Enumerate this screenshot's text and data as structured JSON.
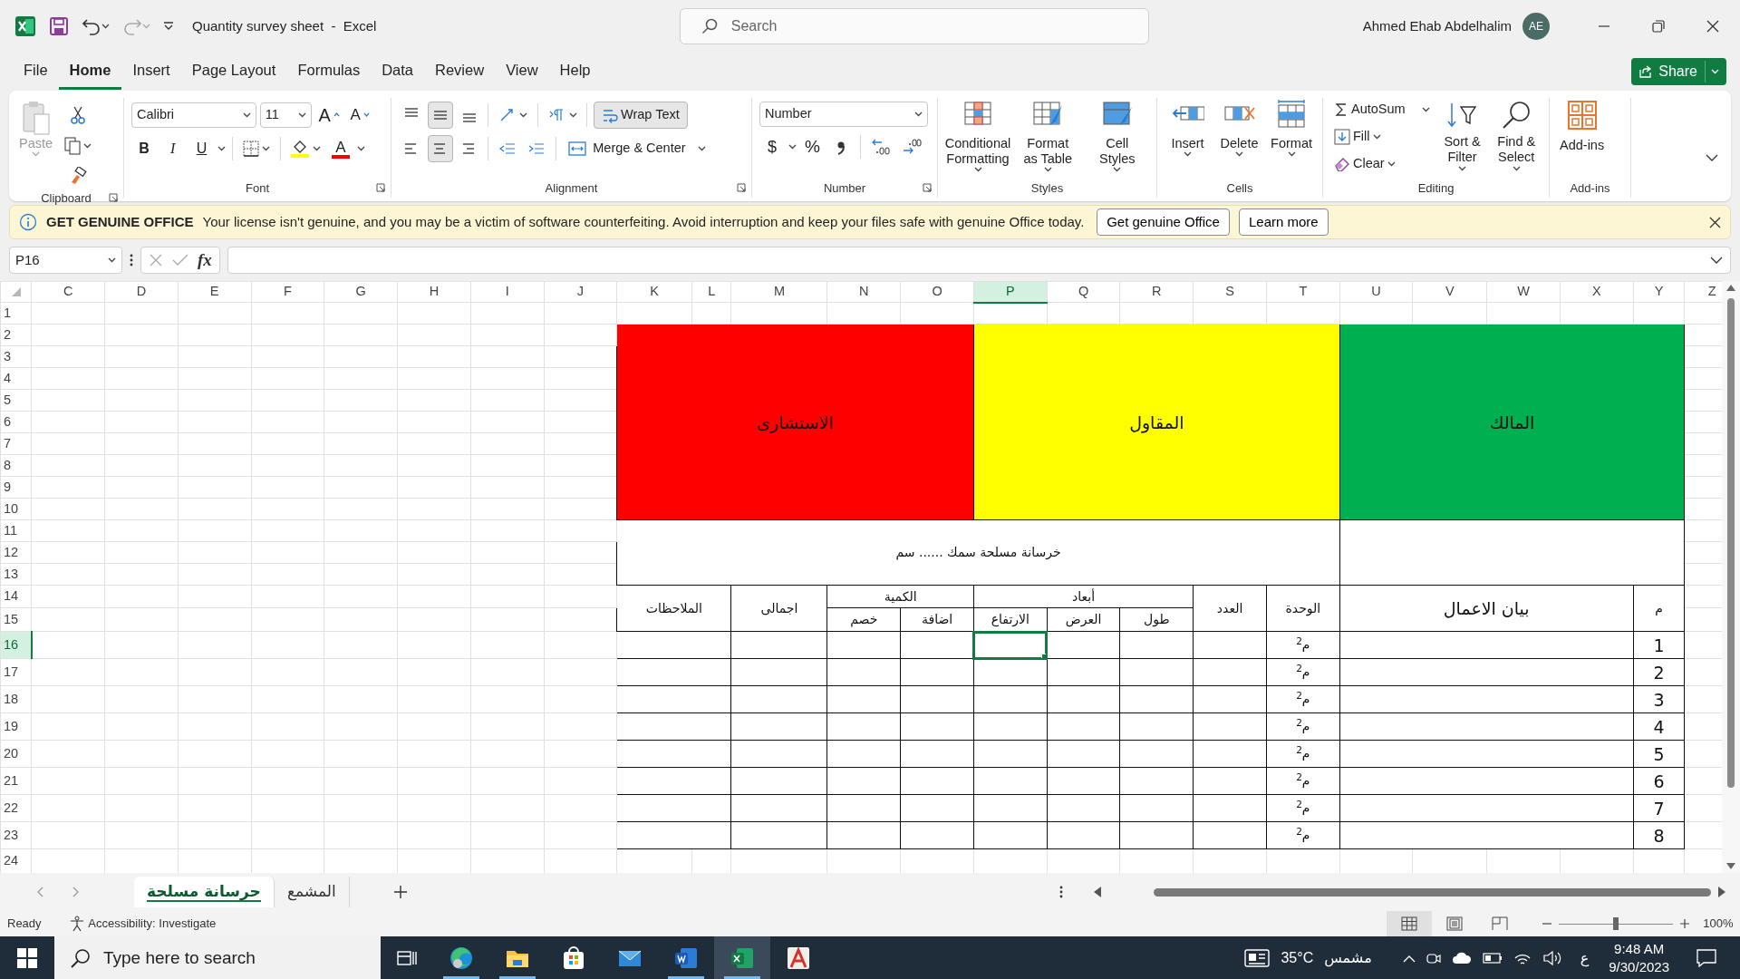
{
  "window": {
    "title": "Quantity survey sheet  -  Excel",
    "search_placeholder": "Search",
    "user": "Ahmed Ehab Abdelhalim",
    "avatar": "AE"
  },
  "menu": [
    {
      "label": "File",
      "selected": false
    },
    {
      "label": "Home",
      "selected": true
    },
    {
      "label": "Insert",
      "selected": false
    },
    {
      "label": "Page Layout",
      "selected": false
    },
    {
      "label": "Formulas",
      "selected": false
    },
    {
      "label": "Data",
      "selected": false
    },
    {
      "label": "Review",
      "selected": false
    },
    {
      "label": "View",
      "selected": false
    },
    {
      "label": "Help",
      "selected": false
    }
  ],
  "share": "Share",
  "ribbon": {
    "clipboard": {
      "label": "Clipboard",
      "paste": "Paste",
      "paste_disabled": true
    },
    "font": {
      "label": "Font",
      "font_name": "Calibri",
      "font_size": "11",
      "grow": "A",
      "shrink": "A",
      "bold": "B",
      "italic": "I",
      "underline": "U",
      "font_color": "A"
    },
    "alignment": {
      "label": "Alignment",
      "vertical": [
        {
          "kind": "top",
          "on": false
        },
        {
          "kind": "middle",
          "on": true
        },
        {
          "kind": "bottom",
          "on": false
        }
      ],
      "horizontal": [
        {
          "kind": "left",
          "on": false
        },
        {
          "kind": "center",
          "on": true
        },
        {
          "kind": "right",
          "on": false
        }
      ],
      "wrap_text": {
        "label": "Wrap Text",
        "on": true
      },
      "merge": "Merge & Center"
    },
    "number": {
      "label": "Number",
      "format": "Number",
      "currency": "$",
      "percent": "%"
    },
    "styles": {
      "label": "Styles",
      "buttons": [
        {
          "kind": "conditional",
          "text": "Conditional Formatting"
        },
        {
          "kind": "table",
          "text": "Format as Table"
        },
        {
          "kind": "cell_styles",
          "text": "Cell Styles"
        }
      ]
    },
    "cells": {
      "label": "Cells",
      "buttons": [
        {
          "kind": "insert",
          "text": "Insert"
        },
        {
          "kind": "delete",
          "text": "Delete"
        },
        {
          "kind": "format",
          "text": "Format"
        }
      ]
    },
    "editing": {
      "label": "Editing",
      "autosum": "AutoSum",
      "fill": "Fill",
      "clear": "Clear",
      "sort": "Sort & Filter",
      "find": "Find & Select"
    },
    "addins": {
      "label": "Add-ins",
      "button": "Add-ins"
    }
  },
  "banner": {
    "title": "GET GENUINE OFFICE",
    "message": "Your license isn't genuine, and you may be a victim of software counterfeiting. Avoid interruption and keep your files safe with genuine Office today.",
    "buttons": [
      "Get genuine Office",
      "Learn more"
    ]
  },
  "formula_bar": {
    "name_box": "P16",
    "fx": "fx"
  },
  "sheet": {
    "columns": [
      {
        "label": "C",
        "selected": false
      },
      {
        "label": "D",
        "selected": false
      },
      {
        "label": "E",
        "selected": false
      },
      {
        "label": "F",
        "selected": false
      },
      {
        "label": "G",
        "selected": false
      },
      {
        "label": "H",
        "selected": false
      },
      {
        "label": "I",
        "selected": false
      },
      {
        "label": "J",
        "selected": false
      },
      {
        "label": "K",
        "selected": false
      },
      {
        "label": "L",
        "selected": false
      },
      {
        "label": "M",
        "selected": false
      },
      {
        "label": "N",
        "selected": false
      },
      {
        "label": "O",
        "selected": false
      },
      {
        "label": "P",
        "selected": true
      },
      {
        "label": "Q",
        "selected": false
      },
      {
        "label": "R",
        "selected": false
      },
      {
        "label": "S",
        "selected": false
      },
      {
        "label": "T",
        "selected": false
      },
      {
        "label": "U",
        "selected": false
      },
      {
        "label": "V",
        "selected": false
      },
      {
        "label": "W",
        "selected": false
      },
      {
        "label": "X",
        "selected": false
      },
      {
        "label": "Y",
        "selected": false
      },
      {
        "label": "Z",
        "selected": false
      }
    ],
    "rows": [
      {
        "label": "1",
        "selected": false
      },
      {
        "label": "2",
        "selected": false
      },
      {
        "label": "3",
        "selected": false
      },
      {
        "label": "4",
        "selected": false
      },
      {
        "label": "5",
        "selected": false
      },
      {
        "label": "6",
        "selected": false
      },
      {
        "label": "7",
        "selected": false
      },
      {
        "label": "8",
        "selected": false
      },
      {
        "label": "9",
        "selected": false
      },
      {
        "label": "10",
        "selected": false
      },
      {
        "label": "11",
        "selected": false
      },
      {
        "label": "12",
        "selected": false
      },
      {
        "label": "13",
        "selected": false
      },
      {
        "label": "14",
        "selected": false
      },
      {
        "label": "15",
        "selected": false
      },
      {
        "label": "16",
        "selected": true
      },
      {
        "label": "17",
        "selected": false
      },
      {
        "label": "18",
        "selected": false
      },
      {
        "label": "19",
        "selected": false
      },
      {
        "label": "20",
        "selected": false
      },
      {
        "label": "21",
        "selected": false
      },
      {
        "label": "22",
        "selected": false
      },
      {
        "label": "23",
        "selected": false
      },
      {
        "label": "24",
        "selected": false
      }
    ],
    "table": {
      "parties": [
        {
          "text": "المالك",
          "color": "#00b050"
        },
        {
          "text": "المقاول",
          "color": "#ffff00"
        },
        {
          "text": "الاستشارى",
          "color": "#ff0000"
        }
      ],
      "title": "خرسانة مسلحة سمك ...... سم",
      "headers": {
        "notes": "الملاحظات",
        "total": "اجمالى",
        "quantity": "الكمية",
        "deduct": "خصم",
        "add": "اضافة",
        "dimensions": "أبعاد",
        "height": "الارتفاع",
        "width": "العرض",
        "length": "طول",
        "count": "العدد",
        "unit": "الوحدة",
        "description": "بيان الاعمال",
        "number": "م"
      },
      "items": [
        {
          "no": "1",
          "unit": "م$^{2}$",
          "height_cell_selected": true
        },
        {
          "no": "2",
          "unit": "م$^{2}$",
          "height_cell_selected": false
        },
        {
          "no": "3",
          "unit": "م$^{2}$",
          "height_cell_selected": false
        },
        {
          "no": "4",
          "unit": "م$^{2}$",
          "height_cell_selected": false
        },
        {
          "no": "5",
          "unit": "م$^{2}$",
          "height_cell_selected": false
        },
        {
          "no": "6",
          "unit": "م$^{2}$",
          "height_cell_selected": false
        },
        {
          "no": "7",
          "unit": "م$^{2}$",
          "height_cell_selected": false
        },
        {
          "no": "8",
          "unit": "م$^{2}$",
          "height_cell_selected": false
        }
      ]
    }
  },
  "sheet_tabs": [
    {
      "label": "المشمع",
      "selected": false
    },
    {
      "label": "حرسانة مسلحة",
      "selected": true
    }
  ],
  "status_bar": {
    "ready": "Ready",
    "accessibility": "Accessibility: Investigate",
    "views": [
      {
        "kind": "normal",
        "selected": true
      },
      {
        "kind": "page_layout",
        "selected": false
      },
      {
        "kind": "page_break",
        "selected": false
      }
    ],
    "zoom": {
      "level": 0.5,
      "reading": "100%"
    }
  },
  "taskbar": {
    "search_placeholder": "Type here to search",
    "apps": [
      {
        "kind": "browser",
        "running": true,
        "active": false
      },
      {
        "kind": "folder",
        "running": true,
        "active": false
      },
      {
        "kind": "store",
        "running": false,
        "active": false
      },
      {
        "kind": "mail",
        "running": false,
        "active": false
      },
      {
        "kind": "word",
        "running": true,
        "active": false
      },
      {
        "kind": "excel",
        "running": true,
        "active": true
      },
      {
        "kind": "acrobat",
        "running": false,
        "active": false
      }
    ],
    "temperature": "35°C",
    "weather": "مشمس",
    "language": "ع",
    "time": "9:48 AM",
    "date": "9/30/2023"
  }
}
